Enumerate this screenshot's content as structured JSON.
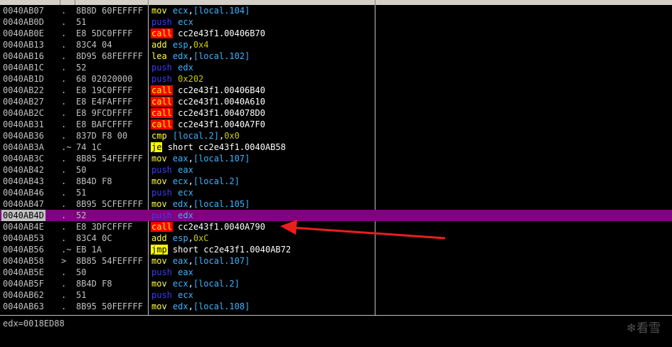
{
  "rows": [
    {
      "addr": "0040AB07",
      "mark": ".",
      "hex": "8B8D 60FEFFFF",
      "mn": "mov",
      "ops": [
        {
          "t": "ecx",
          "k": "reg"
        },
        {
          "t": ",",
          "k": "txt"
        },
        {
          "t": "[local.104]",
          "k": "loc"
        }
      ]
    },
    {
      "addr": "0040AB0D",
      "mark": ".",
      "hex": "51",
      "mn": "push",
      "ops": [
        {
          "t": "ecx",
          "k": "reg"
        }
      ]
    },
    {
      "addr": "0040AB0E",
      "mark": ".",
      "hex": "E8 5DC0FFFF",
      "mn": "call",
      "ops": [
        {
          "t": "cc2e43f1.00406B70",
          "k": "txt"
        }
      ]
    },
    {
      "addr": "0040AB13",
      "mark": ".",
      "hex": "83C4 04",
      "mn": "add",
      "ops": [
        {
          "t": "esp",
          "k": "reg"
        },
        {
          "t": ",",
          "k": "txt"
        },
        {
          "t": "0x4",
          "k": "imm"
        }
      ]
    },
    {
      "addr": "0040AB16",
      "mark": ".",
      "hex": "8D95 68FEFFFF",
      "mn": "lea",
      "ops": [
        {
          "t": "edx",
          "k": "reg"
        },
        {
          "t": ",",
          "k": "txt"
        },
        {
          "t": "[local.102]",
          "k": "loc"
        }
      ]
    },
    {
      "addr": "0040AB1C",
      "mark": ".",
      "hex": "52",
      "mn": "push",
      "ops": [
        {
          "t": "edx",
          "k": "reg"
        }
      ]
    },
    {
      "addr": "0040AB1D",
      "mark": ".",
      "hex": "68 02020000",
      "mn": "push",
      "ops": [
        {
          "t": "0x202",
          "k": "imm"
        }
      ]
    },
    {
      "addr": "0040AB22",
      "mark": ".",
      "hex": "E8 19C0FFFF",
      "mn": "call",
      "ops": [
        {
          "t": "cc2e43f1.00406B40",
          "k": "txt"
        }
      ]
    },
    {
      "addr": "0040AB27",
      "mark": ".",
      "hex": "E8 E4FAFFFF",
      "mn": "call",
      "ops": [
        {
          "t": "cc2e43f1.0040A610",
          "k": "txt"
        }
      ]
    },
    {
      "addr": "0040AB2C",
      "mark": ".",
      "hex": "E8 9FCDFFFF",
      "mn": "call",
      "ops": [
        {
          "t": "cc2e43f1.004078D0",
          "k": "txt"
        }
      ]
    },
    {
      "addr": "0040AB31",
      "mark": ".",
      "hex": "E8 BAFCFFFF",
      "mn": "call",
      "ops": [
        {
          "t": "cc2e43f1.0040A7F0",
          "k": "txt"
        }
      ]
    },
    {
      "addr": "0040AB36",
      "mark": ".",
      "hex": "837D F8 00",
      "mn": "cmp",
      "ops": [
        {
          "t": "[local.2]",
          "k": "loc"
        },
        {
          "t": ",",
          "k": "txt"
        },
        {
          "t": "0x0",
          "k": "imm"
        }
      ]
    },
    {
      "addr": "0040AB3A",
      "mark": ".~",
      "hex": "74 1C",
      "mn": "je",
      "ops": [
        {
          "t": "short cc2e43f1.0040AB58",
          "k": "txt"
        }
      ]
    },
    {
      "addr": "0040AB3C",
      "mark": ".",
      "hex": "8B85 54FEFFFF",
      "mn": "mov",
      "ops": [
        {
          "t": "eax",
          "k": "reg"
        },
        {
          "t": ",",
          "k": "txt"
        },
        {
          "t": "[local.107]",
          "k": "loc"
        }
      ]
    },
    {
      "addr": "0040AB42",
      "mark": ".",
      "hex": "50",
      "mn": "push",
      "ops": [
        {
          "t": "eax",
          "k": "reg"
        }
      ]
    },
    {
      "addr": "0040AB43",
      "mark": ".",
      "hex": "8B4D F8",
      "mn": "mov",
      "ops": [
        {
          "t": "ecx",
          "k": "reg"
        },
        {
          "t": ",",
          "k": "txt"
        },
        {
          "t": "[local.2]",
          "k": "loc"
        }
      ]
    },
    {
      "addr": "0040AB46",
      "mark": ".",
      "hex": "51",
      "mn": "push",
      "ops": [
        {
          "t": "ecx",
          "k": "reg"
        }
      ]
    },
    {
      "addr": "0040AB47",
      "mark": ".",
      "hex": "8B95 5CFEFFFF",
      "mn": "mov",
      "ops": [
        {
          "t": "edx",
          "k": "reg"
        },
        {
          "t": ",",
          "k": "txt"
        },
        {
          "t": "[local.105]",
          "k": "loc"
        }
      ]
    },
    {
      "addr": "0040AB4D",
      "mark": ".",
      "hex": "52",
      "mn": "push",
      "ops": [
        {
          "t": "edx",
          "k": "reg"
        }
      ],
      "selected": true
    },
    {
      "addr": "0040AB4E",
      "mark": ".",
      "hex": "E8 3DFCFFFF",
      "mn": "call",
      "ops": [
        {
          "t": "cc2e43f1.0040A790",
          "k": "txt"
        }
      ]
    },
    {
      "addr": "0040AB53",
      "mark": ".",
      "hex": "83C4 0C",
      "mn": "add",
      "ops": [
        {
          "t": "esp",
          "k": "reg"
        },
        {
          "t": ",",
          "k": "txt"
        },
        {
          "t": "0xC",
          "k": "imm"
        }
      ]
    },
    {
      "addr": "0040AB56",
      "mark": ".~",
      "hex": "EB 1A",
      "mn": "jmp",
      "ops": [
        {
          "t": "short cc2e43f1.0040AB72",
          "k": "txt"
        }
      ]
    },
    {
      "addr": "0040AB58",
      "mark": ">",
      "hex": "8B85 54FEFFFF",
      "mn": "mov",
      "ops": [
        {
          "t": "eax",
          "k": "reg"
        },
        {
          "t": ",",
          "k": "txt"
        },
        {
          "t": "[local.107]",
          "k": "loc"
        }
      ]
    },
    {
      "addr": "0040AB5E",
      "mark": ".",
      "hex": "50",
      "mn": "push",
      "ops": [
        {
          "t": "eax",
          "k": "reg"
        }
      ]
    },
    {
      "addr": "0040AB5F",
      "mark": ".",
      "hex": "8B4D F8",
      "mn": "mov",
      "ops": [
        {
          "t": "ecx",
          "k": "reg"
        },
        {
          "t": ",",
          "k": "txt"
        },
        {
          "t": "[local.2]",
          "k": "loc"
        }
      ]
    },
    {
      "addr": "0040AB62",
      "mark": ".",
      "hex": "51",
      "mn": "push",
      "ops": [
        {
          "t": "ecx",
          "k": "reg"
        }
      ]
    },
    {
      "addr": "0040AB63",
      "mark": ".",
      "hex": "8B95 50FEFFFF",
      "mn": "mov",
      "ops": [
        {
          "t": "edx",
          "k": "reg"
        },
        {
          "t": ",",
          "k": "txt"
        },
        {
          "t": "[local.108]",
          "k": "loc"
        }
      ]
    }
  ],
  "status": {
    "text": "edx=0018ED88"
  },
  "watermark": {
    "text": "看雪",
    "icon": "snowflake-icon"
  },
  "colors": {
    "highlight_row": "#800080",
    "call_bg": "#ff0000",
    "jump_bg": "#ffff00",
    "annotation_arrow": "#e8201c"
  }
}
